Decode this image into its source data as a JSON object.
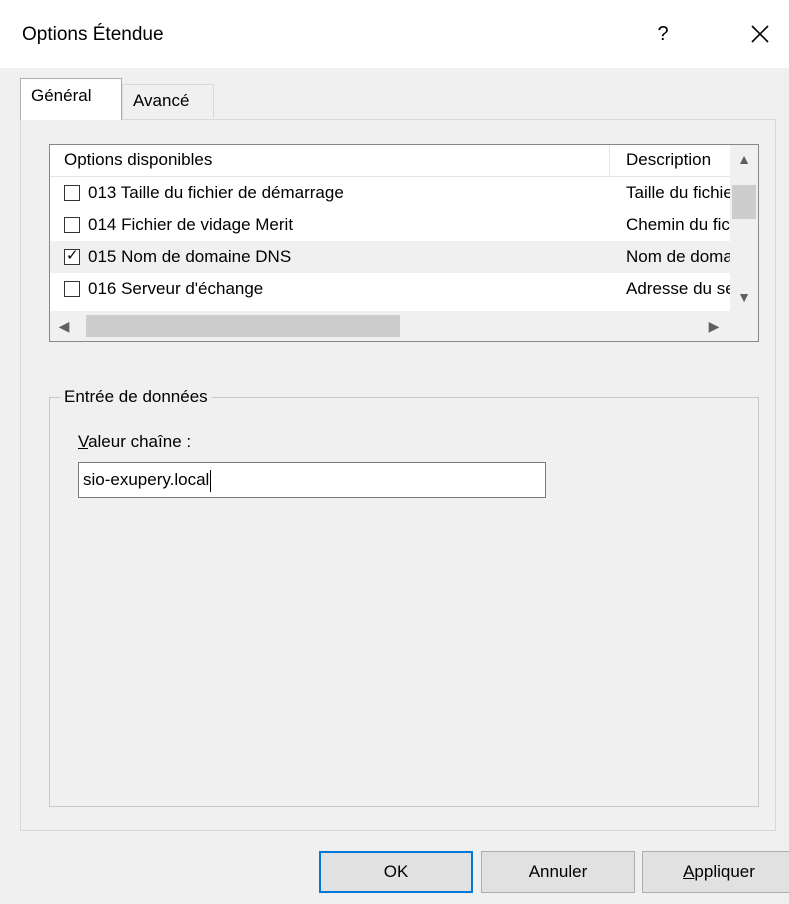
{
  "window": {
    "title": "Options Étendue",
    "help_label": "?",
    "close_icon": "close-icon"
  },
  "tabs": [
    {
      "label": "Général",
      "active": true
    },
    {
      "label": "Avancé",
      "active": false
    }
  ],
  "options_list": {
    "columns": [
      "Options disponibles",
      "Description"
    ],
    "rows": [
      {
        "name": "013 Taille du fichier de démarrage",
        "desc": "Taille du fichier",
        "checked": false,
        "selected": false
      },
      {
        "name": "014 Fichier de vidage Merit",
        "desc": "Chemin du fichier",
        "checked": false,
        "selected": false
      },
      {
        "name": "015 Nom de domaine DNS",
        "desc": "Nom de domaine",
        "checked": true,
        "selected": true
      },
      {
        "name": "016 Serveur d'échange",
        "desc": "Adresse du serveur",
        "checked": false,
        "selected": false
      }
    ],
    "scroll_up_icon": "chevron-up-icon",
    "scroll_down_icon": "chevron-down-icon",
    "scroll_left_icon": "chevron-left-icon",
    "scroll_right_icon": "chevron-right-icon"
  },
  "data_entry": {
    "group_label": "Entrée de données",
    "field_label_accel": "V",
    "field_label_rest": "aleur chaîne :",
    "value": "sio-exupery.local"
  },
  "buttons": {
    "ok": "OK",
    "cancel": "Annuler",
    "apply_accel": "A",
    "apply_rest": "ppliquer"
  }
}
